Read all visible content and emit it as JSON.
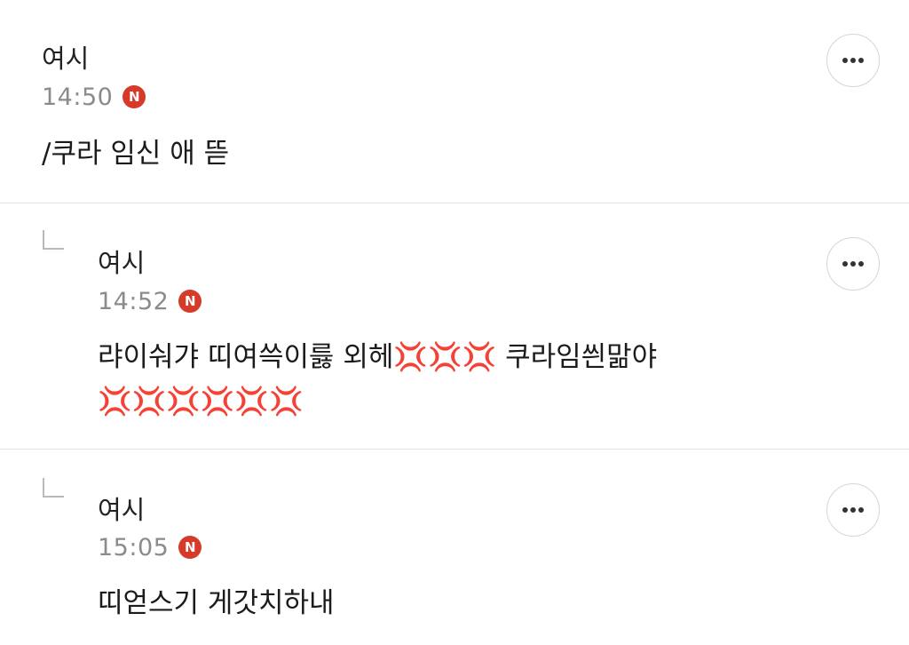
{
  "comments": [
    {
      "author": "여시",
      "time": "14:50",
      "badge": "N",
      "text": "/쿠라 임신 애 뜯",
      "is_reply": false
    },
    {
      "author": "여시",
      "time": "14:52",
      "badge": "N",
      "text": "랴이숴갸 띠여쓱이릃 외헤💢💢💢 쿠라임씐맒야\n💢💢💢💢💢💢",
      "is_reply": true
    },
    {
      "author": "여시",
      "time": "15:05",
      "badge": "N",
      "text": "띠얻스기 게갓치하내",
      "is_reply": true
    }
  ],
  "icons": {
    "more": "more-horizontal-icon",
    "reply": "reply-arrow-icon",
    "badge": "new-badge"
  },
  "colors": {
    "badge": "#d63a28",
    "divider": "#e3e3e3",
    "meta": "#8b8b8b",
    "text": "#1b1b1b"
  }
}
